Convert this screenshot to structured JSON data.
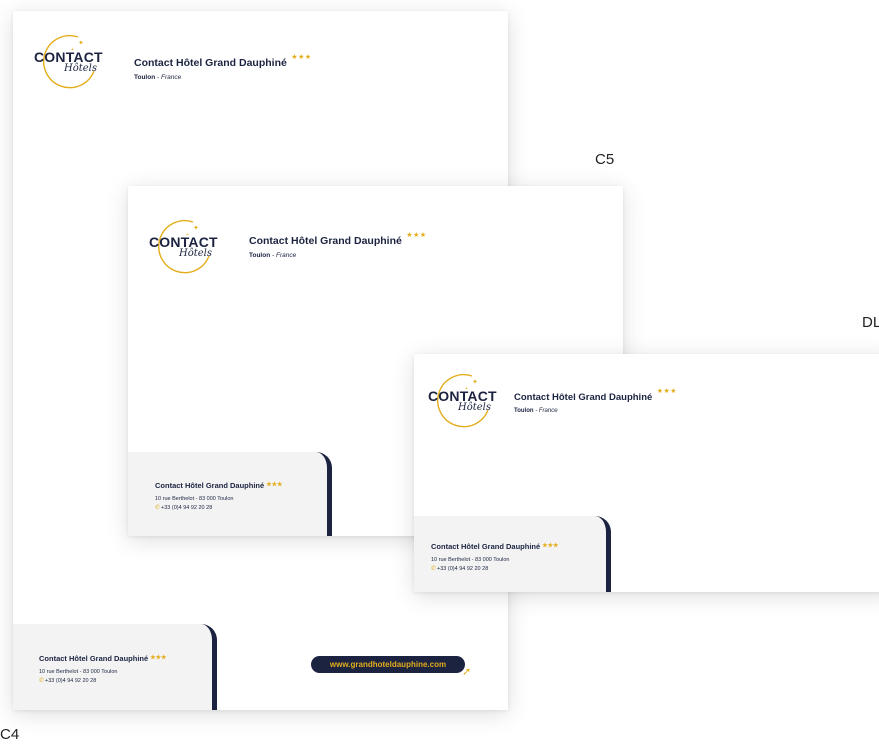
{
  "hotel": {
    "name": "Contact Hôtel Grand Dauphiné",
    "stars": "★★★",
    "city": "Toulon",
    "country_sep": " - ",
    "country": "France",
    "address": "10 rue Berthelot - 83 000 Toulon",
    "phone": "+33 (0)4 94 92 20 28"
  },
  "logo": {
    "word": "CONTACT",
    "script": "Hôtels",
    "sparkles": "+ ✦"
  },
  "website": "www.grandhoteldauphine.com",
  "labels": {
    "c4": "C4",
    "c5": "C5",
    "dl": "DL"
  },
  "colors": {
    "navy": "#1b2340",
    "gold": "#e3ad1c",
    "card_bg": "#f3f3f3"
  },
  "icons": {
    "phone": "phone-icon",
    "cursor": "cursor-icon"
  }
}
